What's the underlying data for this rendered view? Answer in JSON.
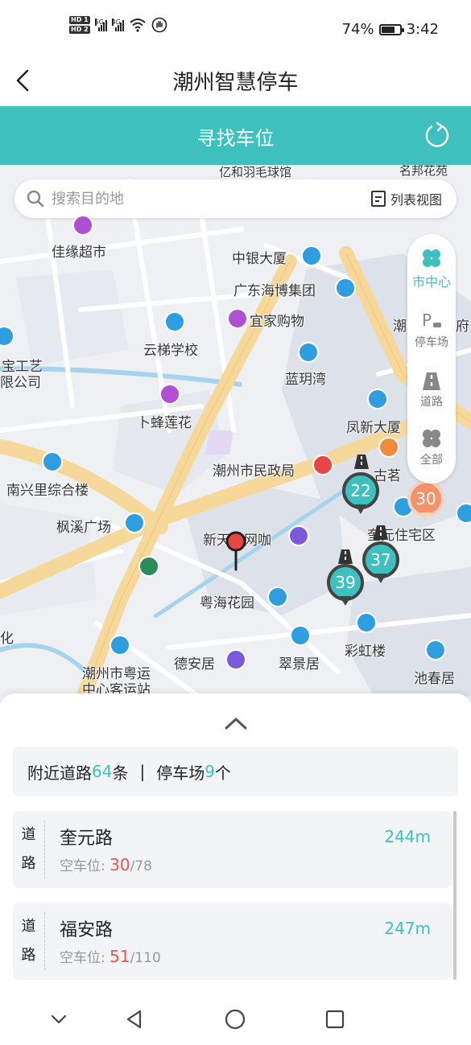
{
  "status_bar": {
    "hd1": "HD 1",
    "hd2": "HD 2",
    "sig1_label": "5G",
    "sig2_label": "4G",
    "battery_pct": "74%",
    "battery_level": 0.74,
    "time": "3:42"
  },
  "header": {
    "title": "潮州智慧停车",
    "subtitle": "寻找车位"
  },
  "search": {
    "placeholder": "搜索目的地",
    "list_view_label": "列表视图"
  },
  "map_filters": [
    {
      "label": "市中心",
      "icon": "clover-icon",
      "active": true
    },
    {
      "label": "停车场",
      "icon": "parking-icon",
      "active": false
    },
    {
      "label": "道路",
      "icon": "road-icon",
      "active": false
    },
    {
      "label": "全部",
      "icon": "clover-icon",
      "active": false
    }
  ],
  "map": {
    "colors": {
      "road": "#f7d89b",
      "block": "#dde2ea",
      "water": "#a8d3ef",
      "teal": "#3ec0bf"
    },
    "places": [
      "亿和羽毛球馆",
      "名邦花苑",
      "佳缘超市",
      "中银大厦",
      "广东海博集团",
      "宜家购物",
      "潮",
      "府",
      "云梯学校",
      "宝工艺",
      "限公司",
      "蓝玥湾",
      "卜蜂莲花",
      "凤新大厦",
      "潮州市民政局",
      "古茗",
      "南兴里综合楼",
      "枫溪广场",
      "新天地网咖",
      "奎元住宅区",
      "粤海花园",
      "化",
      "德安居",
      "翠景居",
      "彩虹楼",
      "池春居",
      "潮州市粤运",
      "中心客运站"
    ],
    "clusters": [
      {
        "count": "22",
        "color": "teal"
      },
      {
        "count": "30",
        "color": "orange"
      },
      {
        "count": "37",
        "color": "teal"
      },
      {
        "count": "39",
        "color": "teal"
      }
    ]
  },
  "sheet": {
    "summary": {
      "road_prefix": "附近道路",
      "road_count": "64",
      "road_unit": "条",
      "separator": "|",
      "lot_prefix": "停车场",
      "lot_count": "9",
      "lot_unit": "个"
    },
    "items": [
      {
        "type_top": "道",
        "type_bottom": "路",
        "name": "奎元路",
        "avail_label": "空车位:",
        "free": "30",
        "total": "/78",
        "distance": "244m"
      },
      {
        "type_top": "道",
        "type_bottom": "路",
        "name": "福安路",
        "avail_label": "空车位:",
        "free": "51",
        "total": "/110",
        "distance": "247m"
      }
    ]
  },
  "nav": {
    "buttons": [
      "chevron-down-icon",
      "back-triangle-icon",
      "home-circle-icon",
      "recents-square-icon"
    ]
  }
}
